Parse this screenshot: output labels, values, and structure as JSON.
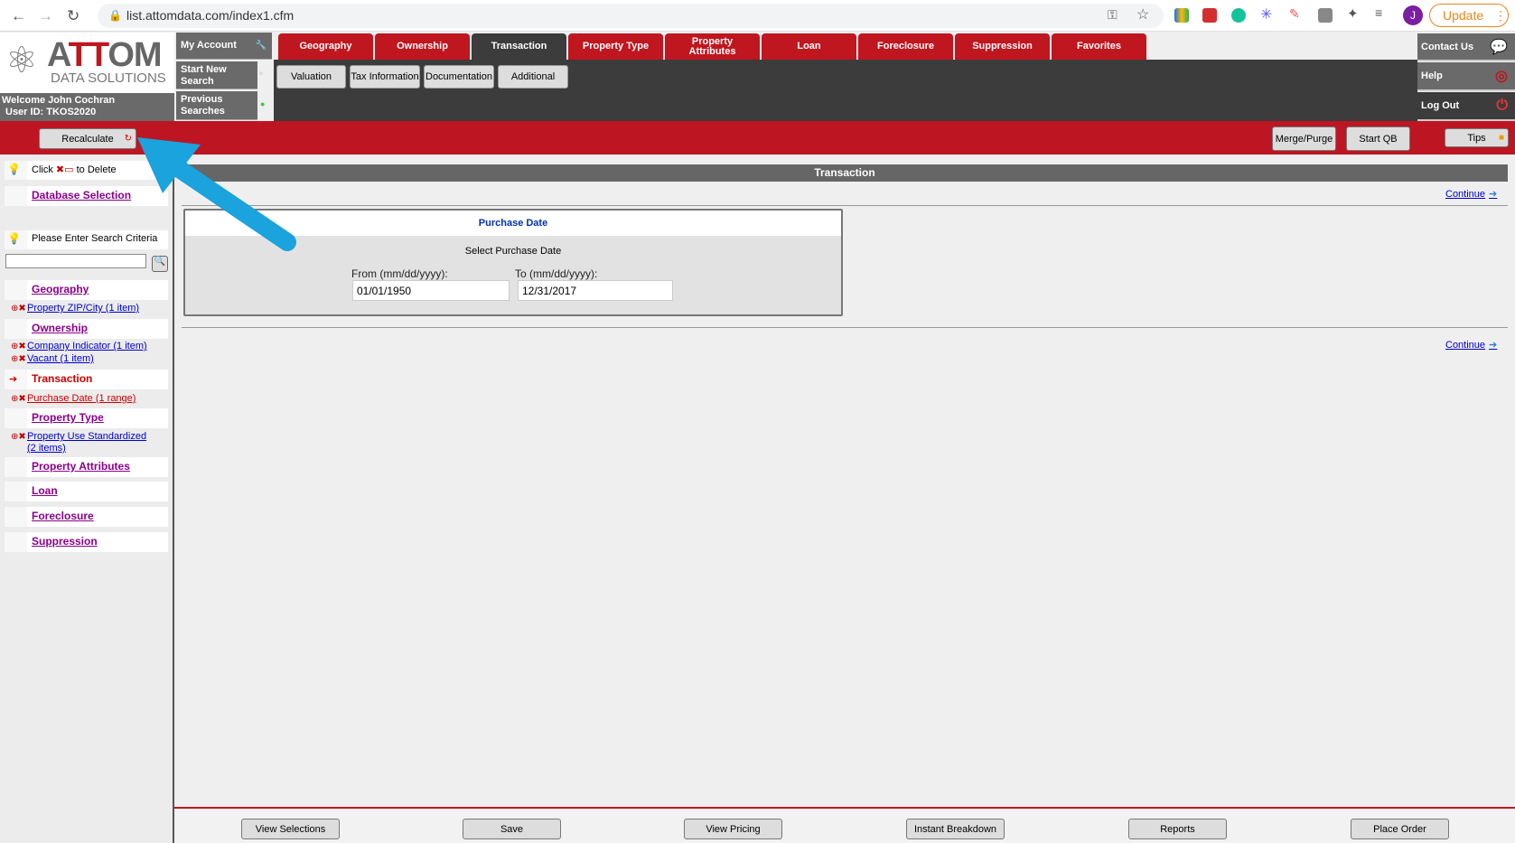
{
  "browser": {
    "url": "list.attomdata.com/index1.cfm",
    "update_label": "Update",
    "avatar_letter": "J"
  },
  "logo": {
    "brand": "ATTOM",
    "tagline": "DATA SOLUTIONS"
  },
  "user": {
    "welcome": "Welcome John Cochran",
    "user_id": "User ID: TKOS2020"
  },
  "left_nav": [
    {
      "label": "My Account"
    },
    {
      "label": "Start New Search"
    },
    {
      "label": "Previous Searches"
    }
  ],
  "tabs": [
    {
      "label": "Geography"
    },
    {
      "label": "Ownership"
    },
    {
      "label": "Transaction",
      "active": true
    },
    {
      "label": "Property Type"
    },
    {
      "label": "Property Attributes"
    },
    {
      "label": "Loan"
    },
    {
      "label": "Foreclosure"
    },
    {
      "label": "Suppression"
    },
    {
      "label": "Favorites"
    }
  ],
  "subtabs": [
    {
      "label": "Valuation"
    },
    {
      "label": "Tax Information"
    },
    {
      "label": "Documentation"
    },
    {
      "label": "Additional"
    }
  ],
  "right_nav": [
    {
      "label": "Contact Us"
    },
    {
      "label": "Help"
    },
    {
      "label": "Log Out"
    }
  ],
  "toolbar": {
    "recalculate": "Recalculate",
    "merge_purge": "Merge/Purge",
    "start_qb": "Start QB",
    "tips": "Tips"
  },
  "sidebar": {
    "click_hint_pre": "Click",
    "click_hint_post": "to Delete",
    "database_selection": "Database Selection",
    "enter_criteria": "Please Enter Search Criteria",
    "search_value": "",
    "sections": [
      {
        "label": "Geography",
        "items": [
          "Property ZIP/City (1 item)"
        ]
      },
      {
        "label": "Ownership",
        "items": [
          "Company Indicator (1 item)",
          "Vacant (1 item)"
        ]
      },
      {
        "label": "Transaction",
        "active": true,
        "items": [
          "Purchase Date (1 range)"
        ]
      },
      {
        "label": "Property Type",
        "items": [
          "Property Use Standardized (2 items)"
        ]
      },
      {
        "label": "Property Attributes",
        "items": []
      },
      {
        "label": "Loan",
        "items": []
      },
      {
        "label": "Foreclosure",
        "items": []
      },
      {
        "label": "Suppression",
        "items": []
      }
    ]
  },
  "main": {
    "section_title": "Transaction",
    "continue": "Continue",
    "panel": {
      "title": "Purchase Date",
      "subtitle": "Select Purchase Date",
      "from_label": "From (mm/dd/yyyy):",
      "to_label": "To (mm/dd/yyyy):",
      "from_value": "01/01/1950",
      "to_value": "12/31/2017"
    }
  },
  "bottom": [
    "View Selections",
    "Save",
    "View Pricing",
    "Instant Breakdown",
    "Reports",
    "Place Order"
  ],
  "colors": {
    "brand_red": "#bd1622",
    "dark": "#3c3c3c",
    "annotation_arrow": "#1aa3dc"
  }
}
